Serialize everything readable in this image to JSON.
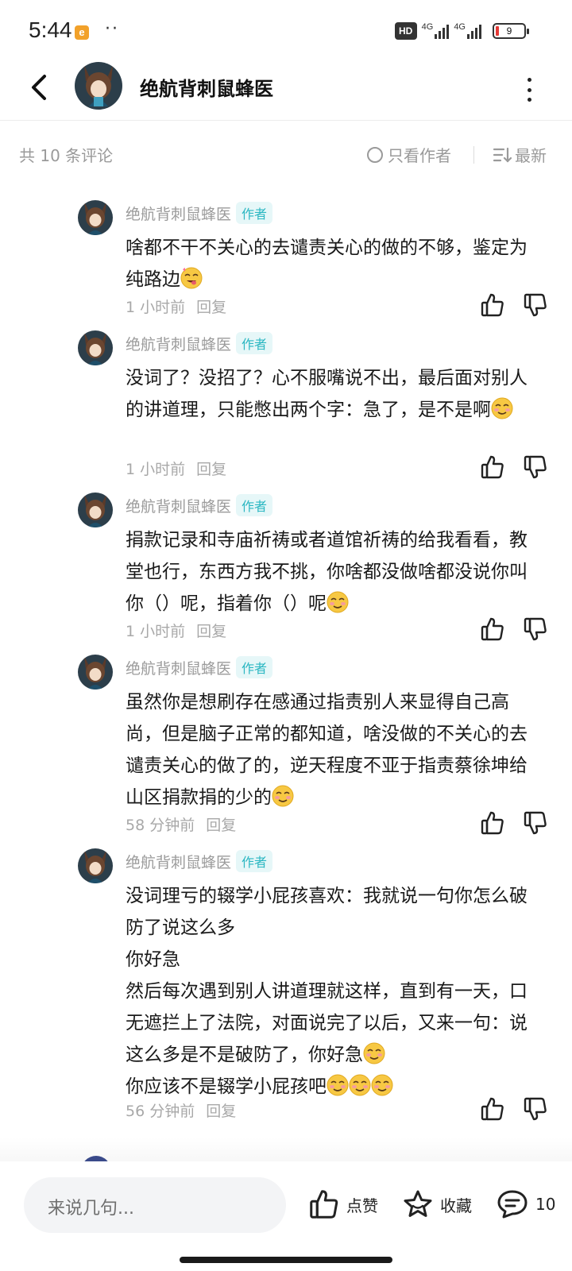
{
  "status_bar": {
    "time": "5:44",
    "app_badge": "e",
    "dots": "··",
    "hd": "HD",
    "net1": "4G",
    "net2": "4G",
    "battery": "9"
  },
  "header": {
    "title": "绝航背刺鼠蜂医"
  },
  "sub_header": {
    "count": "共 10 条评论",
    "only_author": "只看作者",
    "sort": "最新"
  },
  "comments": [
    {
      "name": "绝航背刺鼠蜂医",
      "tag": "作者",
      "text": "啥都不干不关心的去谴责关心的做的不够，鉴定为纯路边",
      "emoji": "😋",
      "time": "1 小时前",
      "reply": "回复"
    },
    {
      "name": "绝航背刺鼠蜂医",
      "tag": "作者",
      "text": "没词了？没招了？心不服嘴说不出，最后面对别人的讲道理，只能憋出两个字：急了，是不是啊",
      "emoji": "😊",
      "time": "1 小时前",
      "reply": "回复"
    },
    {
      "name": "绝航背刺鼠蜂医",
      "tag": "作者",
      "text": "捐款记录和寺庙祈祷或者道馆祈祷的给我看看，教堂也行，东西方我不挑，你啥都没做啥都没说你叫你（）呢，指着你（）呢",
      "emoji": "😊",
      "time": "1 小时前",
      "reply": "回复"
    },
    {
      "name": "绝航背刺鼠蜂医",
      "tag": "作者",
      "text": "虽然你是想刷存在感通过指责别人来显得自己高尚，但是脑子正常的都知道，啥没做的不关心的去谴责关心的做了的，逆天程度不亚于指责蔡徐坤给山区捐款捐的少的",
      "emoji": "😊",
      "time": "58 分钟前",
      "reply": "回复"
    },
    {
      "name": "绝航背刺鼠蜂医",
      "tag": "作者",
      "lines": [
        "没词理亏的辍学小屁孩喜欢：我就说一句你怎么破防了说这么多",
        "你好急",
        "然后每次遇到别人讲道理就这样，直到有一天，口无遮拦上了法院，对面说完了以后，又来一句：说这么多是不是破防了，你好急",
        "你应该不是辍学小屁孩吧"
      ],
      "time": "56 分钟前",
      "reply": "回复"
    }
  ],
  "bottom_bar": {
    "input_placeholder": "来说几句...",
    "like_label": "点赞",
    "fav_label": "收藏",
    "comment_count": "10"
  },
  "colors": {
    "accent_tag": "#2bb7c2",
    "muted_text": "#9a9a9a",
    "battery_low": "#e53935"
  },
  "icons": [
    "back-arrow-icon",
    "more-vertical-icon",
    "radio-circle-icon",
    "sort-lines-icon",
    "thumb-up-icon",
    "thumb-down-icon",
    "star-icon",
    "chat-bubble-icon"
  ]
}
